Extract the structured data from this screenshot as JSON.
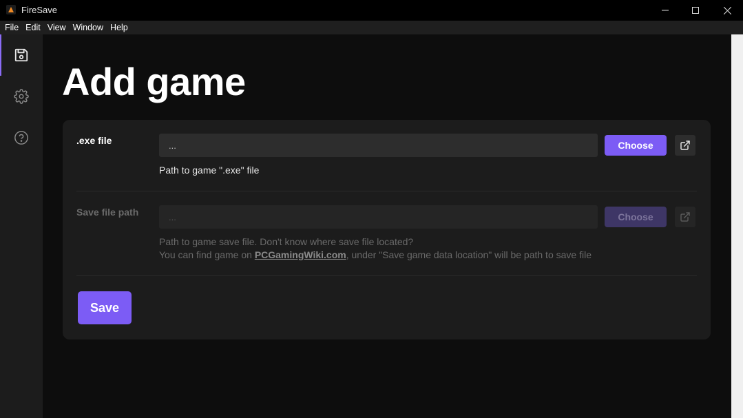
{
  "window": {
    "title": "FireSave"
  },
  "menu": {
    "items": [
      "File",
      "Edit",
      "View",
      "Window",
      "Help"
    ]
  },
  "sidebar": {
    "items": [
      {
        "icon": "save-icon",
        "active": true
      },
      {
        "icon": "gear-icon",
        "active": false
      },
      {
        "icon": "help-icon",
        "active": false
      }
    ]
  },
  "page": {
    "title": "Add game"
  },
  "form": {
    "exe": {
      "label": ".exe file",
      "value": "...",
      "choose_label": "Choose",
      "hint": "Path to game \".exe\" file"
    },
    "save_path": {
      "label": "Save file path",
      "value": "...",
      "choose_label": "Choose",
      "hint_line1": "Path to game save file. Don't know where save file located?",
      "hint_prefix": "You can find game on ",
      "hint_link": "PCGamingWiki.com",
      "hint_suffix": ", under \"Save game data location\" will be path to save file",
      "disabled": true
    },
    "save_label": "Save"
  },
  "colors": {
    "accent": "#7c5cf5",
    "background": "#0d0d0d",
    "card": "#1c1c1c"
  }
}
